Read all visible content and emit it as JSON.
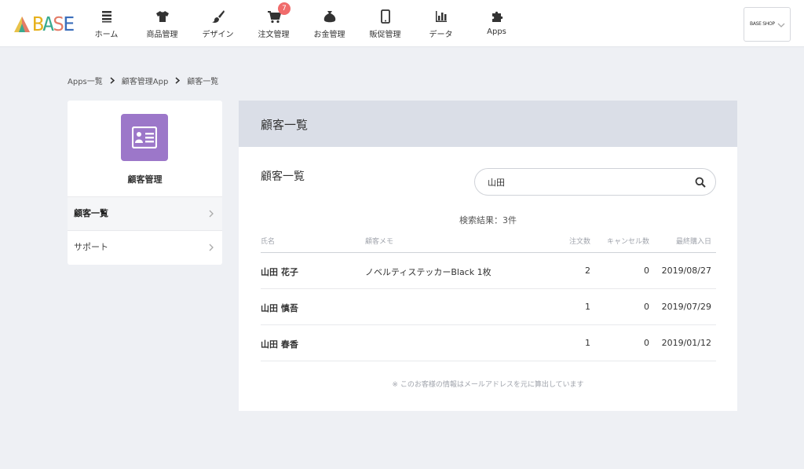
{
  "header": {
    "logo": "BASE",
    "nav": [
      {
        "label": "ホーム",
        "icon": "home-list-icon"
      },
      {
        "label": "商品管理",
        "icon": "tshirt-icon"
      },
      {
        "label": "デザイン",
        "icon": "brush-icon"
      },
      {
        "label": "注文管理",
        "icon": "cart-icon",
        "badge": "7"
      },
      {
        "label": "お金管理",
        "icon": "money-bag-icon"
      },
      {
        "label": "販促管理",
        "icon": "phone-icon"
      },
      {
        "label": "データ",
        "icon": "bar-chart-icon"
      },
      {
        "label": "Apps",
        "icon": "puzzle-icon"
      }
    ],
    "shop_label": "BASE SHOP"
  },
  "breadcrumb": [
    "Apps一覧",
    "顧客管理App",
    "顧客一覧"
  ],
  "sidebar": {
    "app_name": "顧客管理",
    "items": [
      {
        "label": "顧客一覧",
        "active": true
      },
      {
        "label": "サポート",
        "active": false
      }
    ]
  },
  "main": {
    "header_title": "顧客一覧",
    "section_title": "顧客一覧",
    "search": {
      "value": "山田",
      "placeholder": ""
    },
    "result_count": "検索結果：3件",
    "columns": [
      "氏名",
      "顧客メモ",
      "注文数",
      "キャンセル数",
      "最終購入日"
    ],
    "rows": [
      {
        "name": "山田 花子",
        "memo": "ノベルティステッカーBlack 1枚",
        "orders": "2",
        "cancels": "0",
        "last_purchase": "2019/08/27"
      },
      {
        "name": "山田 慎吾",
        "memo": "",
        "orders": "1",
        "cancels": "0",
        "last_purchase": "2019/07/29"
      },
      {
        "name": "山田 春香",
        "memo": "",
        "orders": "1",
        "cancels": "0",
        "last_purchase": "2019/01/12"
      }
    ],
    "footnote": "※ このお客様の情報はメールアドレスを元に算出しています"
  },
  "colors": {
    "app_icon": "#9c77c9",
    "badge": "#f06b6b",
    "header_band": "#dadee7",
    "background": "#eef0f4"
  }
}
